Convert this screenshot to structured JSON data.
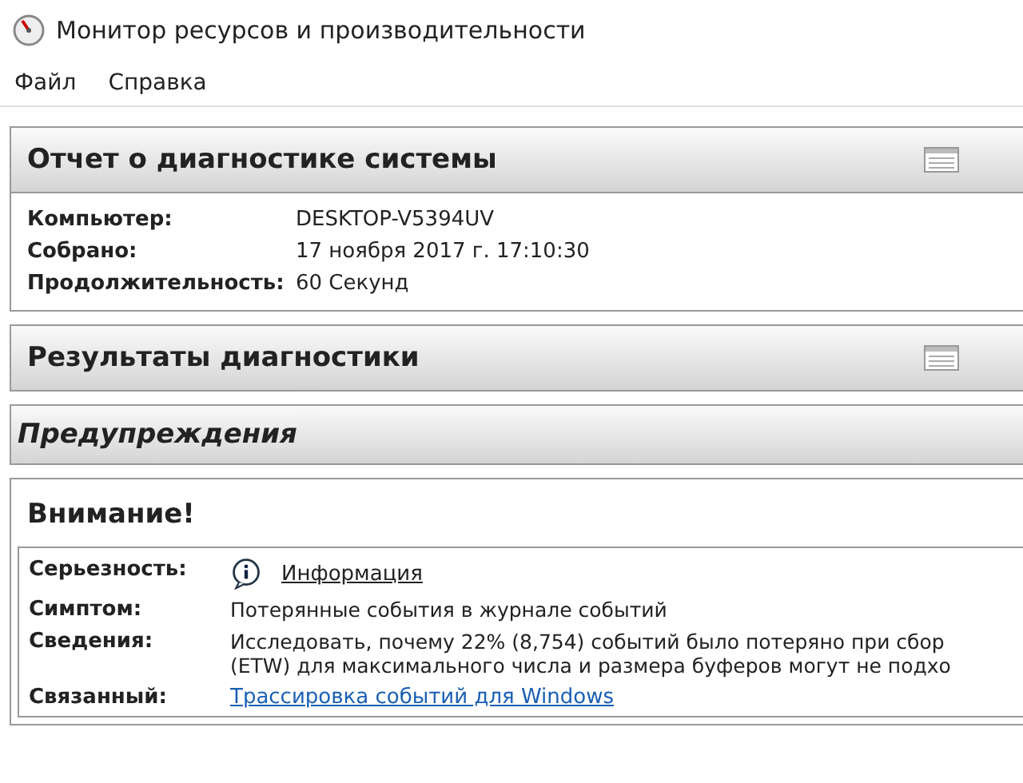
{
  "window": {
    "title": "Монитор ресурсов и производительности"
  },
  "menu": [
    "Файл",
    "Справка"
  ],
  "report": {
    "title": "Отчет о диагностике системы",
    "fields": [
      {
        "label": "Компьютер:",
        "value": "DESKTOP-V5394UV"
      },
      {
        "label": "Собрано:",
        "value": "17 ноября 2017 г. 17:10:30"
      },
      {
        "label": "Продолжительность:",
        "value": "60 Секунд"
      }
    ]
  },
  "results": {
    "title": "Результаты диагностики"
  },
  "warnings": {
    "title": "Предупреждения"
  },
  "alert": {
    "title": "Внимание!",
    "rows": [
      {
        "kind": "severity",
        "label": "Серьезность:",
        "lines": [
          "Информация"
        ]
      },
      {
        "kind": "text",
        "label": "Симптом:",
        "lines": [
          "Потерянные события в журнале событий"
        ]
      },
      {
        "kind": "text",
        "label": "Сведения:",
        "lines": [
          "Исследовать, почему 22% (8,754) событий было потеряно при сбор",
          "(ETW) для максимального числа и размера буферов могут не подхо"
        ]
      },
      {
        "kind": "link",
        "label": "Связанный:",
        "lines": [
          "Трассировка событий для Windows"
        ]
      }
    ]
  }
}
